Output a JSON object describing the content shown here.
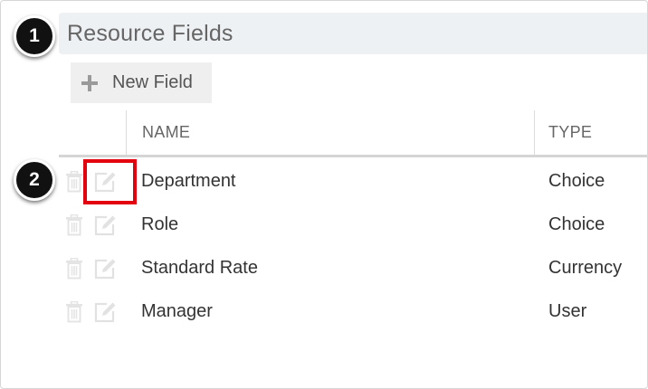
{
  "header": {
    "title": "Resource Fields"
  },
  "callouts": {
    "step1": "1",
    "step2": "2"
  },
  "toolbar": {
    "new_field_label": "New Field",
    "new_field_icon": "plus-icon"
  },
  "table": {
    "columns": {
      "name": "NAME",
      "type": "TYPE"
    },
    "rows": [
      {
        "name": "Department",
        "type": "Choice"
      },
      {
        "name": "Role",
        "type": "Choice"
      },
      {
        "name": "Standard Rate",
        "type": "Currency"
      },
      {
        "name": "Manager",
        "type": "User"
      }
    ],
    "row_icons": [
      "trash-icon",
      "edit-icon"
    ]
  },
  "colors": {
    "header_bg": "#eef1f3",
    "callout_bg": "#111111",
    "highlight": "#e3000f",
    "icon_muted": "#e2e2e2"
  }
}
